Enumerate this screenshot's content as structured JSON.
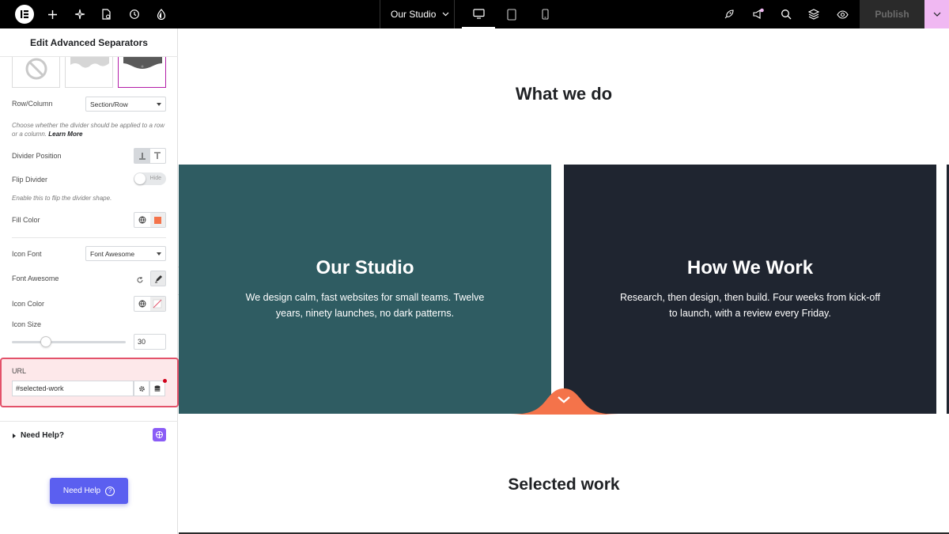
{
  "topbar": {
    "page_name": "Our Studio",
    "publish_label": "Publish"
  },
  "panel": {
    "title": "Edit Advanced Separators",
    "row_column": {
      "label": "Row/Column",
      "value": "Section/Row"
    },
    "row_column_hint": "Choose whether the divider should be applied to a row or a column.",
    "learn_more": "Learn More",
    "divider_position": {
      "label": "Divider Position"
    },
    "flip_divider": {
      "label": "Flip Divider",
      "toggle_text": "Hide",
      "hint": "Enable this to flip the divider shape."
    },
    "fill_color": {
      "label": "Fill Color",
      "swatch": "#f4734a"
    },
    "icon_font": {
      "label": "Icon Font",
      "value": "Font Awesome"
    },
    "font_awesome": {
      "label": "Font Awesome"
    },
    "icon_color": {
      "label": "Icon Color"
    },
    "icon_size": {
      "label": "Icon Size",
      "value": "30"
    },
    "url": {
      "label": "URL",
      "value": "#selected-work"
    },
    "need_help_section": "Need Help?",
    "need_help_button": "Need Help"
  },
  "canvas": {
    "heading_top": "What we do",
    "cards": [
      {
        "title": "Our Studio",
        "text": "We design calm, fast websites for small teams. Twelve years, ninety launches, no dark patterns.",
        "bg": "#2f5c62"
      },
      {
        "title": "How We Work",
        "text": "Research, then design, then build. Four weeks from kick-off to launch, with a review every Friday.",
        "bg": "#1f2530"
      }
    ],
    "divider_color": "#f4734a",
    "heading_bottom": "Selected work"
  }
}
